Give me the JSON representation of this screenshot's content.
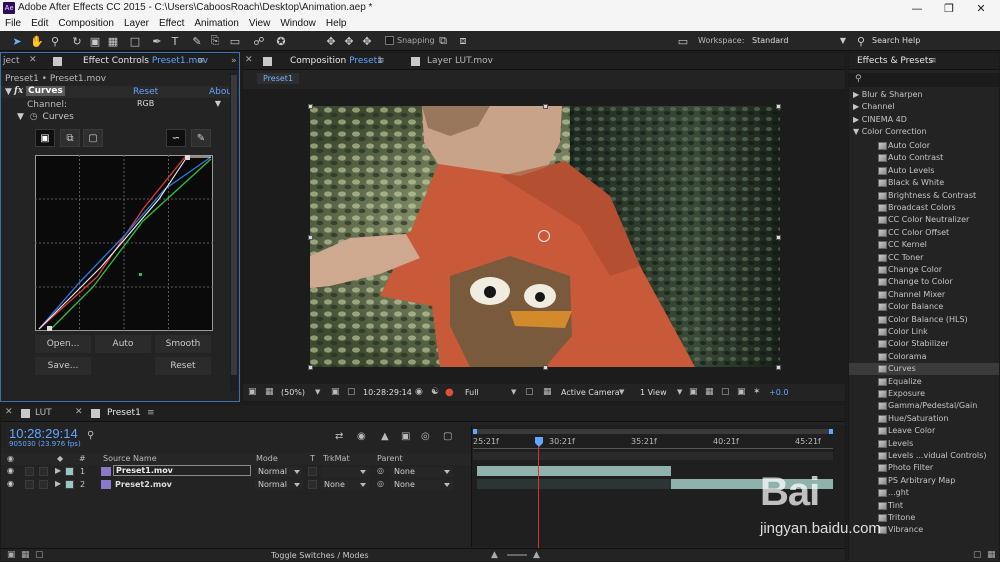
{
  "window": {
    "logo": "Ae",
    "title": "Adobe After Effects CC 2015 - C:\\Users\\CaboosRoach\\Desktop\\Animation.aep *",
    "controls": [
      "minimize-icon",
      "maximize-icon",
      "close-icon"
    ]
  },
  "menu": [
    "File",
    "Edit",
    "Composition",
    "Layer",
    "Effect",
    "Animation",
    "View",
    "Window",
    "Help"
  ],
  "toolbar": {
    "snapping_label": "Snapping",
    "workspace_label": "Workspace:",
    "workspace_value": "Standard",
    "search_help": "Search Help"
  },
  "effect_panel": {
    "tab_left_fragment": "ject",
    "tab_prefix": "Effect Controls ",
    "tab_target": "Preset1.mov",
    "breadcrumb": "Preset1 • Preset1.mov",
    "fx_badge": "fx",
    "effect_name": "Curves",
    "reset_link": "Reset",
    "about_link": "Abou",
    "channel_label": "Channel:",
    "channel_value": "RGB",
    "curves_label": "Curves",
    "buttons": [
      "Open...",
      "Auto",
      "Smooth",
      "Save...",
      "Reset"
    ],
    "curve_points": [
      [
        0,
        0
      ],
      [
        100,
        100
      ]
    ]
  },
  "comp_panel": {
    "tab_prefix": "Composition ",
    "tab_target": "Preset1",
    "tab2_label": "Layer LUT.mov",
    "subtab": "Preset1",
    "zoom": "(50%)",
    "timecode": "10:28:29:14",
    "resolution": "Full",
    "camera": "Active Camera",
    "views": "1 View",
    "exposure": "+0.0"
  },
  "fx_panel": {
    "title": "Effects & Presets",
    "categories": [
      {
        "label": "Blur & Sharpen",
        "expanded": false
      },
      {
        "label": "Channel",
        "expanded": false
      },
      {
        "label": "CINEMA 4D",
        "expanded": false
      },
      {
        "label": "Color Correction",
        "expanded": true
      }
    ],
    "items": [
      "Auto Color",
      "Auto Contrast",
      "Auto Levels",
      "Black & White",
      "Brightness & Contrast",
      "Broadcast Colors",
      "CC Color Neutralizer",
      "CC Color Offset",
      "CC Kernel",
      "CC Toner",
      "Change Color",
      "Change to Color",
      "Channel Mixer",
      "Color Balance",
      "Color Balance (HLS)",
      "Color Link",
      "Color Stabilizer",
      "Colorama",
      "Curves",
      "Equalize",
      "Exposure",
      "Gamma/Pedestal/Gain",
      "Hue/Saturation",
      "Leave Color",
      "Levels",
      "Levels ...vidual Controls)",
      "Photo Filter",
      "PS Arbitrary Map",
      "...ght",
      "Tint",
      "Tritone",
      "Vibrance"
    ],
    "selected": "Curves"
  },
  "timeline": {
    "tab1": "LUT",
    "tab2": "Preset1",
    "timecode": "10:28:29:14",
    "frames": "905030 (23.976 fps)",
    "headers": {
      "hash": "#",
      "source": "Source Name",
      "mode": "Mode",
      "t": "T",
      "trkmat": "TrkMat",
      "parent": "Parent"
    },
    "layers": [
      {
        "num": "1",
        "name": "Preset1.mov",
        "mode": "Normal",
        "trkmat": "",
        "parent": "None"
      },
      {
        "num": "2",
        "name": "Preset2.mov",
        "mode": "Normal",
        "trkmat": "None",
        "parent": "None"
      }
    ],
    "ruler": [
      "25:21f",
      "30:21f",
      "35:21f",
      "40:21f",
      "45:21f"
    ],
    "toggle_label": "Toggle Switches / Modes"
  },
  "watermark": {
    "line1": "Bai",
    "line2": "jingyan.baidu.com"
  }
}
